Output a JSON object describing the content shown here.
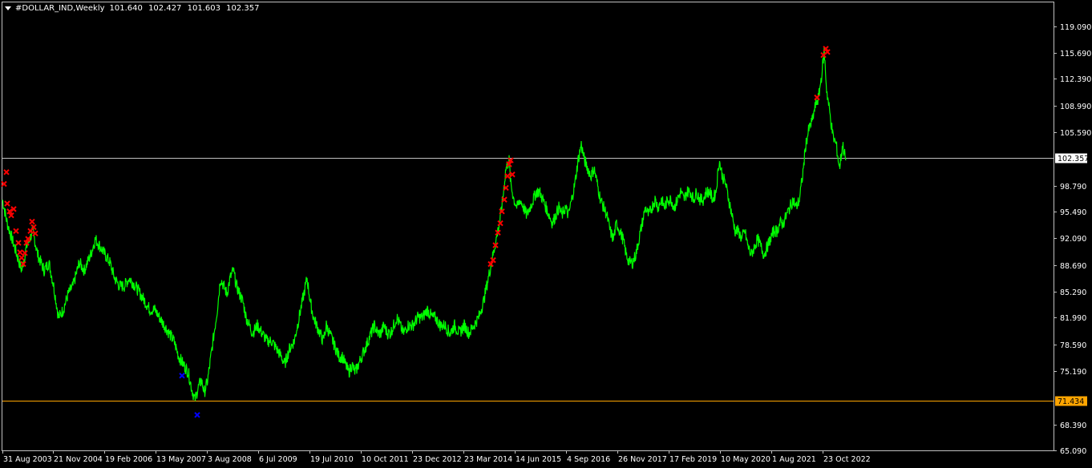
{
  "header": {
    "symbol": "#DOLLAR_IND,Weekly",
    "open": "101.640",
    "high": "102.427",
    "low": "101.603",
    "close": "102.357"
  },
  "colors": {
    "background": "#000000",
    "price_line": "#00ff00",
    "frame": "#c0c0c0",
    "axis_text": "#ffffff",
    "current_price_line": "#c0c0c0",
    "level_line": "#ffa500",
    "sell_mark": "#ff0000",
    "buy_mark": "#0000ff"
  },
  "chart_data": {
    "type": "line",
    "ylim": [
      65.09,
      122.1
    ],
    "y_ticks": [
      "119.090",
      "115.690",
      "112.390",
      "108.990",
      "105.590",
      "98.790",
      "95.490",
      "92.090",
      "88.690",
      "85.290",
      "81.990",
      "78.590",
      "75.190",
      "68.390",
      "65.090"
    ],
    "x_ticks": [
      "31 Aug 2003",
      "21 Nov 2004",
      "19 Feb 2006",
      "13 May 2007",
      "3 Aug 2008",
      "6 Jul 2009",
      "19 Jul 2010",
      "10 Oct 2011",
      "23 Dec 2012",
      "23 Mar 2014",
      "14 Jun 2015",
      "4 Sep 2016",
      "26 Nov 2017",
      "17 Feb 2019",
      "10 May 2020",
      "1 Aug 2021",
      "23 Oct 2022"
    ],
    "current_price": {
      "label": "102.357",
      "value": 102.357
    },
    "level_line": {
      "label": "71.434",
      "value": 71.434
    },
    "series": [
      {
        "points": [
          [
            0,
            97
          ],
          [
            6,
            94
          ],
          [
            12,
            92
          ],
          [
            18,
            90
          ],
          [
            24,
            88
          ],
          [
            30,
            91
          ],
          [
            38,
            93
          ],
          [
            44,
            90
          ],
          [
            52,
            88
          ],
          [
            58,
            89
          ],
          [
            64,
            86
          ],
          [
            70,
            82
          ],
          [
            76,
            83
          ],
          [
            82,
            85
          ],
          [
            88,
            86
          ],
          [
            96,
            89
          ],
          [
            102,
            88
          ],
          [
            110,
            90
          ],
          [
            116,
            92
          ],
          [
            122,
            91
          ],
          [
            128,
            90
          ],
          [
            134,
            89
          ],
          [
            140,
            87
          ],
          [
            146,
            86
          ],
          [
            152,
            86
          ],
          [
            158,
            87
          ],
          [
            166,
            86
          ],
          [
            172,
            85
          ],
          [
            178,
            84
          ],
          [
            184,
            83
          ],
          [
            190,
            83
          ],
          [
            196,
            82
          ],
          [
            202,
            81
          ],
          [
            208,
            80
          ],
          [
            214,
            79
          ],
          [
            220,
            77
          ],
          [
            226,
            76
          ],
          [
            232,
            75
          ],
          [
            236,
            73
          ],
          [
            240,
            71.5
          ],
          [
            244,
            73
          ],
          [
            248,
            74
          ],
          [
            252,
            72.5
          ],
          [
            256,
            74
          ],
          [
            260,
            77
          ],
          [
            264,
            80
          ],
          [
            268,
            83
          ],
          [
            272,
            87
          ],
          [
            276,
            86
          ],
          [
            280,
            85
          ],
          [
            284,
            87
          ],
          [
            288,
            88
          ],
          [
            292,
            86
          ],
          [
            296,
            85
          ],
          [
            300,
            84
          ],
          [
            304,
            82
          ],
          [
            308,
            81
          ],
          [
            312,
            80
          ],
          [
            318,
            81
          ],
          [
            324,
            80
          ],
          [
            330,
            79
          ],
          [
            336,
            79
          ],
          [
            342,
            78
          ],
          [
            348,
            77
          ],
          [
            352,
            76
          ],
          [
            358,
            78
          ],
          [
            364,
            79
          ],
          [
            370,
            82
          ],
          [
            376,
            85
          ],
          [
            380,
            87
          ],
          [
            384,
            84
          ],
          [
            388,
            82
          ],
          [
            392,
            81
          ],
          [
            396,
            80
          ],
          [
            400,
            79
          ],
          [
            404,
            81
          ],
          [
            408,
            80
          ],
          [
            412,
            79
          ],
          [
            416,
            78
          ],
          [
            420,
            77
          ],
          [
            424,
            77
          ],
          [
            428,
            76
          ],
          [
            432,
            75
          ],
          [
            436,
            76
          ],
          [
            440,
            75
          ],
          [
            444,
            76
          ],
          [
            448,
            77
          ],
          [
            452,
            78
          ],
          [
            456,
            79
          ],
          [
            460,
            80
          ],
          [
            464,
            81
          ],
          [
            468,
            80
          ],
          [
            472,
            80
          ],
          [
            476,
            81
          ],
          [
            480,
            80
          ],
          [
            484,
            80
          ],
          [
            488,
            81
          ],
          [
            492,
            82
          ],
          [
            496,
            81
          ],
          [
            500,
            80
          ],
          [
            506,
            81
          ],
          [
            512,
            81
          ],
          [
            518,
            82
          ],
          [
            524,
            82
          ],
          [
            530,
            83
          ],
          [
            536,
            82
          ],
          [
            540,
            82
          ],
          [
            546,
            81
          ],
          [
            552,
            81
          ],
          [
            558,
            80
          ],
          [
            564,
            81
          ],
          [
            570,
            80
          ],
          [
            576,
            81
          ],
          [
            582,
            80
          ],
          [
            588,
            81
          ],
          [
            594,
            82
          ],
          [
            600,
            84
          ],
          [
            604,
            86
          ],
          [
            608,
            88
          ],
          [
            612,
            90
          ],
          [
            616,
            92
          ],
          [
            620,
            94
          ],
          [
            624,
            97
          ],
          [
            628,
            101
          ],
          [
            632,
            102
          ],
          [
            634,
            99
          ],
          [
            638,
            97
          ],
          [
            642,
            96
          ],
          [
            646,
            97
          ],
          [
            650,
            96
          ],
          [
            654,
            95
          ],
          [
            658,
            96
          ],
          [
            662,
            97
          ],
          [
            666,
            98
          ],
          [
            670,
            98
          ],
          [
            674,
            97
          ],
          [
            678,
            96
          ],
          [
            682,
            95
          ],
          [
            686,
            94
          ],
          [
            690,
            95
          ],
          [
            694,
            96
          ],
          [
            698,
            95
          ],
          [
            702,
            96
          ],
          [
            706,
            95
          ],
          [
            710,
            97
          ],
          [
            714,
            99
          ],
          [
            718,
            102
          ],
          [
            722,
            104
          ],
          [
            726,
            102
          ],
          [
            730,
            101
          ],
          [
            734,
            100
          ],
          [
            738,
            101
          ],
          [
            742,
            99
          ],
          [
            746,
            97
          ],
          [
            750,
            96
          ],
          [
            754,
            95
          ],
          [
            758,
            93
          ],
          [
            762,
            92
          ],
          [
            766,
            94
          ],
          [
            770,
            93
          ],
          [
            774,
            92
          ],
          [
            778,
            90
          ],
          [
            782,
            89
          ],
          [
            786,
            89
          ],
          [
            790,
            90
          ],
          [
            794,
            92
          ],
          [
            798,
            94
          ],
          [
            802,
            96
          ],
          [
            806,
            95
          ],
          [
            810,
            96
          ],
          [
            814,
            97
          ],
          [
            818,
            96
          ],
          [
            822,
            97
          ],
          [
            826,
            96
          ],
          [
            830,
            97
          ],
          [
            834,
            97
          ],
          [
            838,
            96
          ],
          [
            842,
            97
          ],
          [
            846,
            98
          ],
          [
            850,
            97
          ],
          [
            854,
            98
          ],
          [
            858,
            98
          ],
          [
            862,
            97
          ],
          [
            866,
            98
          ],
          [
            870,
            97
          ],
          [
            874,
            97
          ],
          [
            878,
            98
          ],
          [
            882,
            98
          ],
          [
            886,
            97
          ],
          [
            890,
            98
          ],
          [
            894,
            102
          ],
          [
            898,
            100
          ],
          [
            902,
            99
          ],
          [
            906,
            97
          ],
          [
            910,
            95
          ],
          [
            914,
            93
          ],
          [
            918,
            93
          ],
          [
            922,
            92
          ],
          [
            926,
            93
          ],
          [
            930,
            91
          ],
          [
            934,
            90
          ],
          [
            938,
            91
          ],
          [
            942,
            92
          ],
          [
            946,
            91
          ],
          [
            950,
            90
          ],
          [
            954,
            91
          ],
          [
            958,
            92
          ],
          [
            962,
            93
          ],
          [
            966,
            93
          ],
          [
            970,
            94
          ],
          [
            974,
            94
          ],
          [
            978,
            95
          ],
          [
            982,
            96
          ],
          [
            986,
            97
          ],
          [
            990,
            96
          ],
          [
            994,
            97
          ],
          [
            998,
            100
          ],
          [
            1002,
            104
          ],
          [
            1006,
            106
          ],
          [
            1010,
            107
          ],
          [
            1014,
            109
          ],
          [
            1018,
            110
          ],
          [
            1022,
            113
          ],
          [
            1025,
            116
          ],
          [
            1028,
            111
          ],
          [
            1032,
            108
          ],
          [
            1036,
            105
          ],
          [
            1040,
            104
          ],
          [
            1044,
            101
          ],
          [
            1048,
            104
          ],
          [
            1052,
            102
          ]
        ]
      }
    ],
    "sell_marks": [
      [
        2,
        99
      ],
      [
        5,
        100.5
      ],
      [
        6,
        96.5
      ],
      [
        9,
        95.5
      ],
      [
        11,
        95
      ],
      [
        14,
        95.8
      ],
      [
        17,
        93
      ],
      [
        20,
        91.5
      ],
      [
        22,
        90.3
      ],
      [
        24,
        89.6
      ],
      [
        26,
        88.8
      ],
      [
        28,
        90.2
      ],
      [
        30,
        91.5
      ],
      [
        32,
        92
      ],
      [
        35,
        93
      ],
      [
        37,
        94.2
      ],
      [
        39,
        93.5
      ],
      [
        41,
        92.7
      ],
      [
        609,
        88.8
      ],
      [
        612,
        89.3
      ],
      [
        615,
        91.2
      ],
      [
        618,
        92.8
      ],
      [
        621,
        94
      ],
      [
        623,
        95.5
      ],
      [
        626,
        97
      ],
      [
        628,
        98.5
      ],
      [
        630,
        100
      ],
      [
        632,
        101.5
      ],
      [
        634,
        102
      ],
      [
        636,
        100.2
      ],
      [
        1016,
        110
      ],
      [
        1024,
        115.4
      ],
      [
        1027,
        116.2
      ],
      [
        1029,
        115.8
      ]
    ],
    "buy_marks": [
      [
        224,
        74.6
      ],
      [
        243,
        69.6
      ]
    ]
  }
}
